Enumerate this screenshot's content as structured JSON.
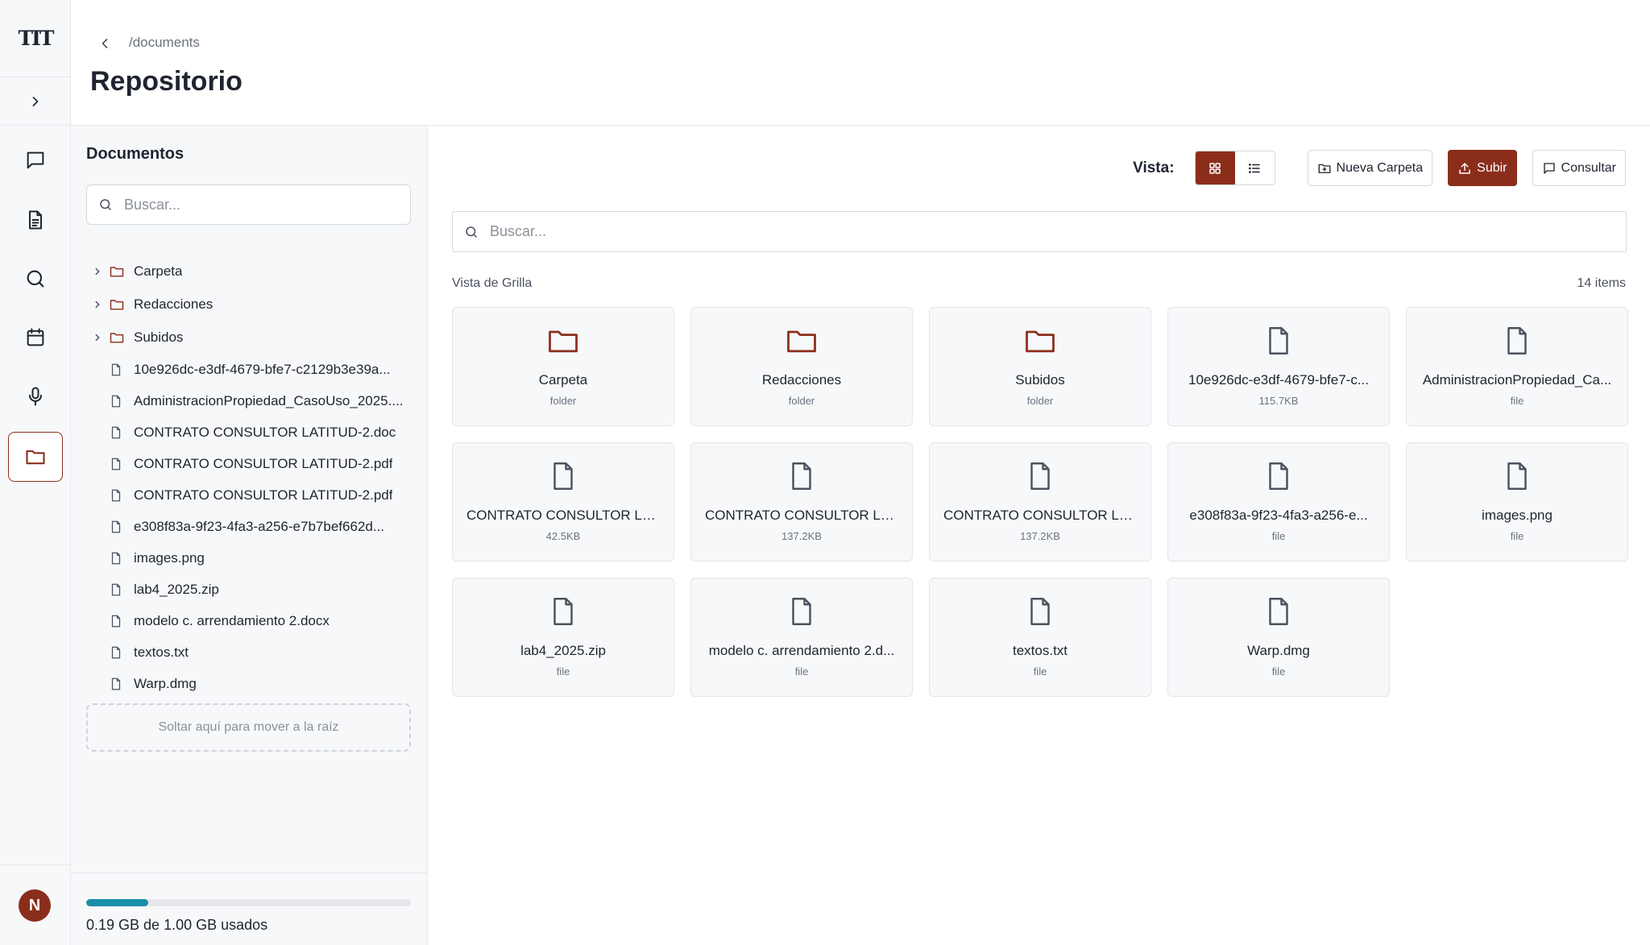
{
  "app": {
    "logo_text": "TIT",
    "avatar_initial": "N"
  },
  "header": {
    "breadcrumb": "/documents",
    "title": "Repositorio"
  },
  "sidebar": {
    "title": "Documentos",
    "search_placeholder": "Buscar...",
    "tree": [
      {
        "type": "folder",
        "label": "Carpeta"
      },
      {
        "type": "folder",
        "label": "Redacciones"
      },
      {
        "type": "folder",
        "label": "Subidos"
      },
      {
        "type": "file",
        "label": "10e926dc-e3df-4679-bfe7-c2129b3e39a..."
      },
      {
        "type": "file",
        "label": "AdministracionPropiedad_CasoUso_2025...."
      },
      {
        "type": "file",
        "label": "CONTRATO CONSULTOR LATITUD-2.doc"
      },
      {
        "type": "file",
        "label": "CONTRATO CONSULTOR LATITUD-2.pdf"
      },
      {
        "type": "file",
        "label": "CONTRATO CONSULTOR LATITUD-2.pdf"
      },
      {
        "type": "file",
        "label": "e308f83a-9f23-4fa3-a256-e7b7bef662d..."
      },
      {
        "type": "file",
        "label": "images.png"
      },
      {
        "type": "file",
        "label": "lab4_2025.zip"
      },
      {
        "type": "file",
        "label": "modelo c. arrendamiento 2.docx"
      },
      {
        "type": "file",
        "label": "textos.txt"
      },
      {
        "type": "file",
        "label": "Warp.dmg"
      }
    ],
    "drop_zone": "Soltar aquí para mover a la raíz",
    "storage": {
      "text": "0.19 GB de 1.00 GB usados",
      "used_fraction": 0.19
    }
  },
  "toolbar": {
    "view_label": "Vista:",
    "new_folder": "Nueva Carpeta",
    "upload": "Subir",
    "consult": "Consultar"
  },
  "main": {
    "search_placeholder": "Buscar...",
    "grid_label": "Vista de Grilla",
    "item_count": "14 items",
    "items": [
      {
        "type": "folder",
        "name": "Carpeta",
        "meta": "folder"
      },
      {
        "type": "folder",
        "name": "Redacciones",
        "meta": "folder"
      },
      {
        "type": "folder",
        "name": "Subidos",
        "meta": "folder"
      },
      {
        "type": "file",
        "name": "10e926dc-e3df-4679-bfe7-c...",
        "meta": "115.7KB"
      },
      {
        "type": "file",
        "name": "AdministracionPropiedad_Ca...",
        "meta": "file"
      },
      {
        "type": "file",
        "name": "CONTRATO CONSULTOR LAT...",
        "meta": "42.5KB"
      },
      {
        "type": "file",
        "name": "CONTRATO CONSULTOR LAT...",
        "meta": "137.2KB"
      },
      {
        "type": "file",
        "name": "CONTRATO CONSULTOR LAT...",
        "meta": "137.2KB"
      },
      {
        "type": "file",
        "name": "e308f83a-9f23-4fa3-a256-e...",
        "meta": "file"
      },
      {
        "type": "file",
        "name": "images.png",
        "meta": "file"
      },
      {
        "type": "file",
        "name": "lab4_2025.zip",
        "meta": "file"
      },
      {
        "type": "file",
        "name": "modelo c. arrendamiento 2.d...",
        "meta": "file"
      },
      {
        "type": "file",
        "name": "textos.txt",
        "meta": "file"
      },
      {
        "type": "file",
        "name": "Warp.dmg",
        "meta": "file"
      }
    ]
  },
  "colors": {
    "accent": "#8a2e1b",
    "storage_fill": "#1a8fa8"
  }
}
